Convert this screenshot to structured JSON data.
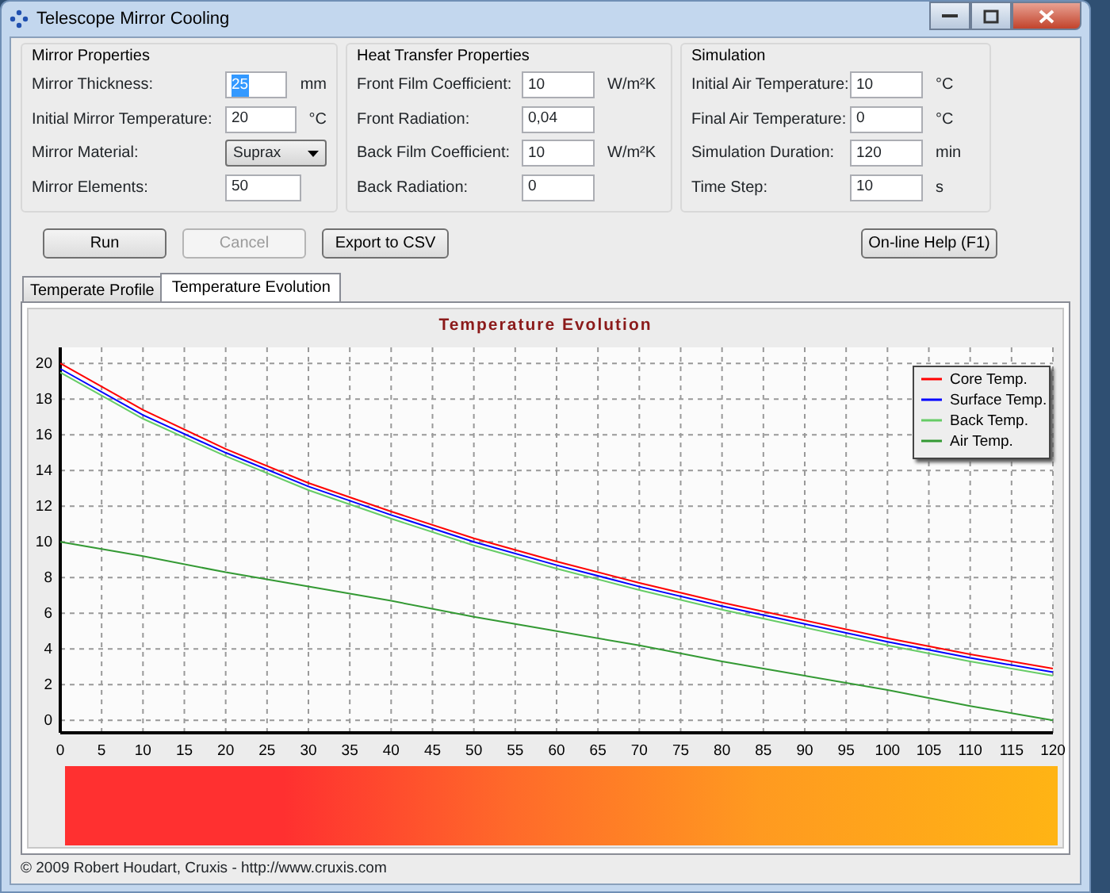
{
  "window": {
    "title": "Telescope Mirror Cooling"
  },
  "groups": [
    {
      "title": "Mirror Properties",
      "fields": [
        {
          "label": "Mirror Thickness:",
          "kind": "text",
          "value": "25",
          "unit": "mm",
          "focused": true
        },
        {
          "label": "Initial Mirror Temperature:",
          "kind": "text",
          "value": "20",
          "unit": "°C",
          "focused": false
        },
        {
          "label": "Mirror Material:",
          "kind": "select",
          "value": "Suprax"
        },
        {
          "label": "Mirror Elements:",
          "kind": "text",
          "value": "50",
          "focused": false
        }
      ]
    },
    {
      "title": "Heat Transfer Properties",
      "fields": [
        {
          "label": "Front Film Coefficient:",
          "kind": "text",
          "value": "10",
          "unit": "W/m²K",
          "focused": false
        },
        {
          "label": "Front Radiation:",
          "kind": "text",
          "value": "0,04",
          "focused": false
        },
        {
          "label": "Back Film Coefficient:",
          "kind": "text",
          "value": "10",
          "unit": "W/m²K",
          "focused": false
        },
        {
          "label": "Back Radiation:",
          "kind": "text",
          "value": "0",
          "focused": false
        }
      ]
    },
    {
      "title": "Simulation",
      "fields": [
        {
          "label": "Initial Air Temperature:",
          "kind": "text",
          "value": "10",
          "unit": "°C",
          "focused": false
        },
        {
          "label": "Final Air Temperature:",
          "kind": "text",
          "value": "0",
          "unit": "°C",
          "focused": false
        },
        {
          "label": "Simulation Duration:",
          "kind": "text",
          "value": "120",
          "unit": "min",
          "focused": false
        },
        {
          "label": "Time Step:",
          "kind": "text",
          "value": "10",
          "unit": "s",
          "focused": false
        }
      ]
    }
  ],
  "buttons": [
    {
      "label": "Run",
      "disabled": false
    },
    {
      "label": "Cancel",
      "disabled": true
    },
    {
      "label": "Export to CSV",
      "disabled": false
    }
  ],
  "help_button": {
    "label": "On-line Help (F1)"
  },
  "tabs": [
    {
      "label": "Temperate Profile",
      "selected": false
    },
    {
      "label": "Temperature Evolution",
      "selected": true
    }
  ],
  "chart_data": {
    "type": "line",
    "title": "Temperature Evolution",
    "x": [
      0,
      10,
      20,
      30,
      40,
      50,
      60,
      70,
      80,
      90,
      100,
      110,
      120
    ],
    "series": [
      {
        "name": "Core Temp.",
        "color": "#ff0000",
        "values": [
          20,
          17.4,
          15.2,
          13.3,
          11.7,
          10.2,
          8.9,
          7.7,
          6.6,
          5.6,
          4.6,
          3.7,
          2.9
        ]
      },
      {
        "name": "Surface Temp.",
        "color": "#0000ff",
        "values": [
          19.7,
          17.1,
          15,
          13.1,
          11.5,
          10,
          8.7,
          7.5,
          6.4,
          5.4,
          4.4,
          3.5,
          2.7
        ]
      },
      {
        "name": "Back Temp.",
        "color": "#66cc66",
        "values": [
          19.5,
          16.9,
          14.8,
          12.9,
          11.3,
          9.8,
          8.5,
          7.3,
          6.2,
          5.2,
          4.2,
          3.3,
          2.5
        ]
      },
      {
        "name": "Air Temp.",
        "color": "#339933",
        "values": [
          10,
          9.2,
          8.3,
          7.5,
          6.7,
          5.8,
          5,
          4.2,
          3.3,
          2.5,
          1.7,
          0.8,
          0
        ]
      }
    ],
    "grid": true,
    "legend": true,
    "xlim": [
      0,
      120
    ],
    "ylim": [
      -0.7,
      20.9
    ],
    "xticks": [
      0,
      5,
      10,
      15,
      20,
      25,
      30,
      35,
      40,
      45,
      50,
      55,
      60,
      65,
      70,
      75,
      80,
      85,
      90,
      95,
      100,
      105,
      110,
      115,
      120
    ],
    "yticks": [
      0,
      2,
      4,
      6,
      8,
      10,
      12,
      14,
      16,
      18,
      20
    ]
  },
  "status_bar": {
    "text": "© 2009 Robert Houdart, Cruxis  -  http://www.cruxis.com"
  }
}
